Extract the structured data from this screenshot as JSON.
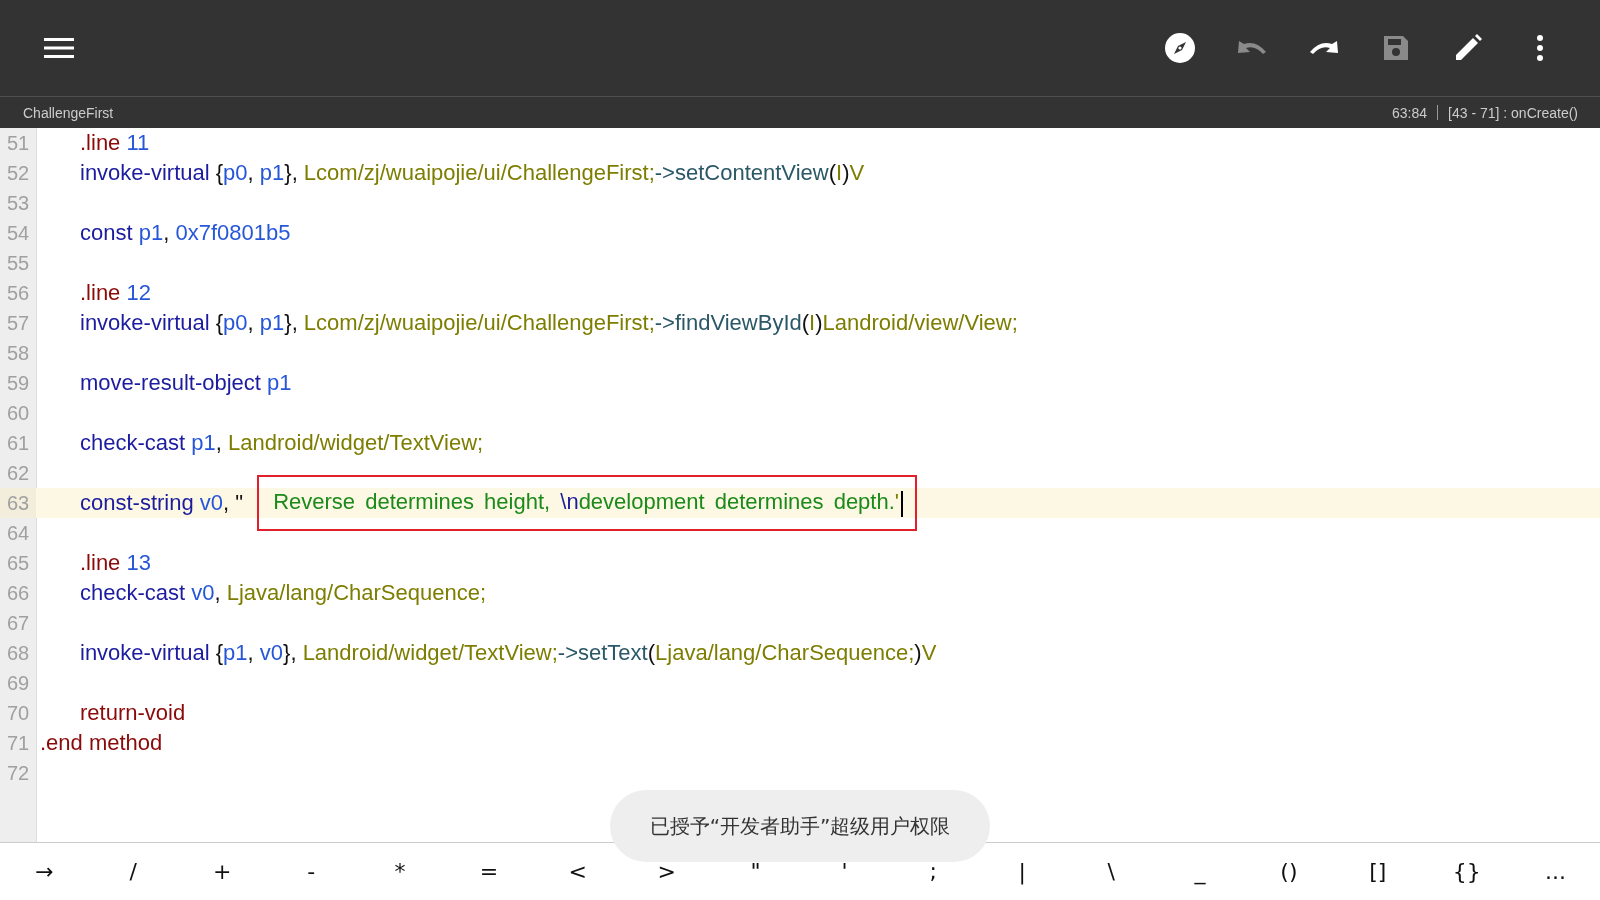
{
  "toolbar": {
    "actions": [
      {
        "kind": "compass",
        "disabled": false
      },
      {
        "kind": "undo",
        "disabled": true
      },
      {
        "kind": "redo",
        "disabled": false
      },
      {
        "kind": "save",
        "disabled": true
      },
      {
        "kind": "edit",
        "disabled": false
      },
      {
        "kind": "more",
        "disabled": false
      }
    ]
  },
  "subheader": {
    "file": "ChallengeFirst",
    "position": "63:84",
    "scope": "[43 - 71] : onCreate()"
  },
  "lines": [
    {
      "number": "51",
      "indented": true,
      "current": false,
      "segments": [
        {
          "outlined": false,
          "tokens": [
            {
              "text": ".line ",
              "kind": "directive"
            },
            {
              "text": "11",
              "kind": "register"
            }
          ]
        }
      ]
    },
    {
      "number": "52",
      "indented": true,
      "current": false,
      "segments": [
        {
          "outlined": false,
          "tokens": [
            {
              "text": "invoke-virtual ",
              "kind": "keyword"
            },
            {
              "text": "{",
              "kind": "punct"
            },
            {
              "text": "p0",
              "kind": "register"
            },
            {
              "text": ", ",
              "kind": "punct"
            },
            {
              "text": "p1",
              "kind": "register"
            },
            {
              "text": "}, ",
              "kind": "punct"
            },
            {
              "text": "Lcom/zj/wuaipojie/ui/ChallengeFirst;",
              "kind": "type"
            },
            {
              "text": "->setContentView",
              "kind": "method"
            },
            {
              "text": "(",
              "kind": "punct"
            },
            {
              "text": "I",
              "kind": "type"
            },
            {
              "text": ")",
              "kind": "punct"
            },
            {
              "text": "V",
              "kind": "type"
            }
          ]
        }
      ]
    },
    {
      "number": "53",
      "current": false
    },
    {
      "number": "54",
      "indented": true,
      "current": false,
      "segments": [
        {
          "outlined": false,
          "tokens": [
            {
              "text": "const ",
              "kind": "keyword"
            },
            {
              "text": "p1",
              "kind": "register"
            },
            {
              "text": ", ",
              "kind": "punct"
            },
            {
              "text": "0x7f0801b5",
              "kind": "register"
            }
          ]
        }
      ]
    },
    {
      "number": "55",
      "current": false
    },
    {
      "number": "56",
      "indented": true,
      "current": false,
      "segments": [
        {
          "outlined": false,
          "tokens": [
            {
              "text": ".line ",
              "kind": "directive"
            },
            {
              "text": "12",
              "kind": "register"
            }
          ]
        }
      ]
    },
    {
      "number": "57",
      "indented": true,
      "current": false,
      "segments": [
        {
          "outlined": false,
          "tokens": [
            {
              "text": "invoke-virtual ",
              "kind": "keyword"
            },
            {
              "text": "{",
              "kind": "punct"
            },
            {
              "text": "p0",
              "kind": "register"
            },
            {
              "text": ", ",
              "kind": "punct"
            },
            {
              "text": "p1",
              "kind": "register"
            },
            {
              "text": "}, ",
              "kind": "punct"
            },
            {
              "text": "Lcom/zj/wuaipojie/ui/ChallengeFirst;",
              "kind": "type"
            },
            {
              "text": "->findViewById",
              "kind": "method"
            },
            {
              "text": "(",
              "kind": "punct"
            },
            {
              "text": "I",
              "kind": "type"
            },
            {
              "text": ")",
              "kind": "punct"
            },
            {
              "text": "Landroid/view/View;",
              "kind": "type"
            }
          ]
        }
      ]
    },
    {
      "number": "58",
      "current": false
    },
    {
      "number": "59",
      "indented": true,
      "current": false,
      "segments": [
        {
          "outlined": false,
          "tokens": [
            {
              "text": "move-result-object ",
              "kind": "keyword"
            },
            {
              "text": "p1",
              "kind": "register"
            }
          ]
        }
      ]
    },
    {
      "number": "60",
      "current": false
    },
    {
      "number": "61",
      "indented": true,
      "current": false,
      "segments": [
        {
          "outlined": false,
          "tokens": [
            {
              "text": "check-cast ",
              "kind": "keyword"
            },
            {
              "text": "p1",
              "kind": "register"
            },
            {
              "text": ", ",
              "kind": "punct"
            },
            {
              "text": "Landroid/widget/TextView;",
              "kind": "type"
            }
          ]
        }
      ]
    },
    {
      "number": "62",
      "current": false
    },
    {
      "number": "63",
      "indented": true,
      "current": true,
      "segments": [
        {
          "outlined": false,
          "tokens": [
            {
              "text": "const-string ",
              "kind": "keyword"
            },
            {
              "text": "v0",
              "kind": "register"
            },
            {
              "text": ", \"",
              "kind": "punct"
            }
          ]
        },
        {
          "outlined": true,
          "cursor": true,
          "tokens": [
            {
              "text": "Reverse determines height, ",
              "kind": "string"
            },
            {
              "text": "\\n",
              "kind": "keyword"
            },
            {
              "text": "development determines depth.",
              "kind": "string"
            },
            {
              "text": "'",
              "kind": "type"
            }
          ]
        }
      ]
    },
    {
      "number": "64",
      "current": false
    },
    {
      "number": "65",
      "indented": true,
      "current": false,
      "segments": [
        {
          "outlined": false,
          "tokens": [
            {
              "text": ".line ",
              "kind": "directive"
            },
            {
              "text": "13",
              "kind": "register"
            }
          ]
        }
      ]
    },
    {
      "number": "66",
      "indented": true,
      "current": false,
      "segments": [
        {
          "outlined": false,
          "tokens": [
            {
              "text": "check-cast ",
              "kind": "keyword"
            },
            {
              "text": "v0",
              "kind": "register"
            },
            {
              "text": ", ",
              "kind": "punct"
            },
            {
              "text": "Ljava/lang/CharSequence;",
              "kind": "type"
            }
          ]
        }
      ]
    },
    {
      "number": "67",
      "current": false
    },
    {
      "number": "68",
      "indented": true,
      "current": false,
      "segments": [
        {
          "outlined": false,
          "tokens": [
            {
              "text": "invoke-virtual ",
              "kind": "keyword"
            },
            {
              "text": "{",
              "kind": "punct"
            },
            {
              "text": "p1",
              "kind": "register"
            },
            {
              "text": ", ",
              "kind": "punct"
            },
            {
              "text": "v0",
              "kind": "register"
            },
            {
              "text": "}, ",
              "kind": "punct"
            },
            {
              "text": "Landroid/widget/TextView;",
              "kind": "type"
            },
            {
              "text": "->setText",
              "kind": "method"
            },
            {
              "text": "(",
              "kind": "punct"
            },
            {
              "text": "Ljava/lang/CharSequence;",
              "kind": "type"
            },
            {
              "text": ")",
              "kind": "punct"
            },
            {
              "text": "V",
              "kind": "type"
            }
          ]
        }
      ]
    },
    {
      "number": "69",
      "current": false
    },
    {
      "number": "70",
      "indented": true,
      "current": false,
      "segments": [
        {
          "outlined": false,
          "tokens": [
            {
              "text": "return-void",
              "kind": "directive"
            }
          ]
        }
      ]
    },
    {
      "number": "71",
      "indented": false,
      "current": false,
      "segments": [
        {
          "outlined": false,
          "tokens": [
            {
              "text": ".end method",
              "kind": "directive"
            }
          ]
        }
      ]
    },
    {
      "number": "72",
      "current": false
    }
  ],
  "toast": "已授予“开发者助手”超级用户权限",
  "symbol_keys": [
    "→",
    "/",
    "+",
    "-",
    "*",
    "=",
    "<",
    ">",
    "\"",
    "'",
    ";",
    "|",
    "\\",
    "_",
    "()",
    "[]",
    "{}",
    "..."
  ]
}
